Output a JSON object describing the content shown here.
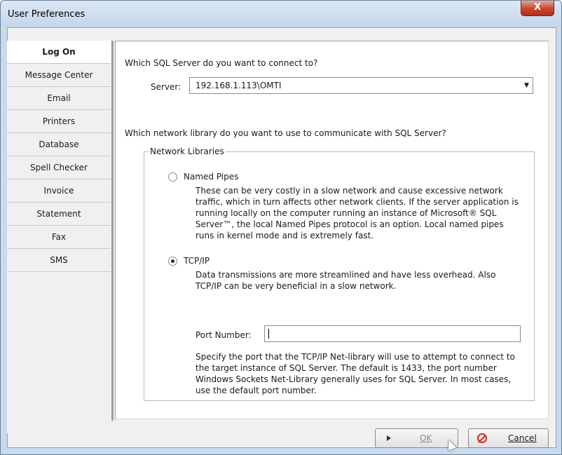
{
  "window": {
    "title": "User Preferences",
    "close_label": "X"
  },
  "sidebar": {
    "items": [
      {
        "label": "Log On"
      },
      {
        "label": "Message Center"
      },
      {
        "label": "Email"
      },
      {
        "label": "Printers"
      },
      {
        "label": "Database"
      },
      {
        "label": "Spell Checker"
      },
      {
        "label": "Invoice"
      },
      {
        "label": "Statement"
      },
      {
        "label": "Fax"
      },
      {
        "label": "SMS"
      }
    ],
    "active": "Log On"
  },
  "logon": {
    "question_server": "Which SQL Server do you want to connect to?",
    "server_label": "Server:",
    "server_value": "192.168.1.113\\OMTI",
    "question_library": "Which network library do you want to use to communicate with SQL Server?",
    "group_label": "Network Libraries",
    "named_pipes": {
      "label": "Named Pipes",
      "checked": false,
      "description": "These can be very costly in a slow network and cause excessive network traffic, which in turn affects other network clients. If the server application is running locally on the computer running an instance of Microsoft® SQL Server™, the local Named Pipes protocol is an option. Local named pipes runs in kernel mode and is extremely fast."
    },
    "tcpip": {
      "label": "TCP/IP",
      "checked": true,
      "description": "Data transmissions are more streamlined and have less overhead. Also TCP/IP can be very beneficial in a slow network.",
      "port_label": "Port Number:",
      "port_value": "",
      "port_note": "Specify the port that the TCP/IP Net-library will use to attempt to connect to the target instance of SQL Server. The default is 1433, the port number Windows Sockets Net-Library generally uses for SQL Server. In most cases, use the default port number."
    }
  },
  "buttons": {
    "ok": "OK",
    "cancel": "Cancel"
  },
  "icons": {
    "ok": "play-icon",
    "cancel": "no-entry-icon",
    "close": "close-icon",
    "dropdown": "chevron-down-icon"
  }
}
